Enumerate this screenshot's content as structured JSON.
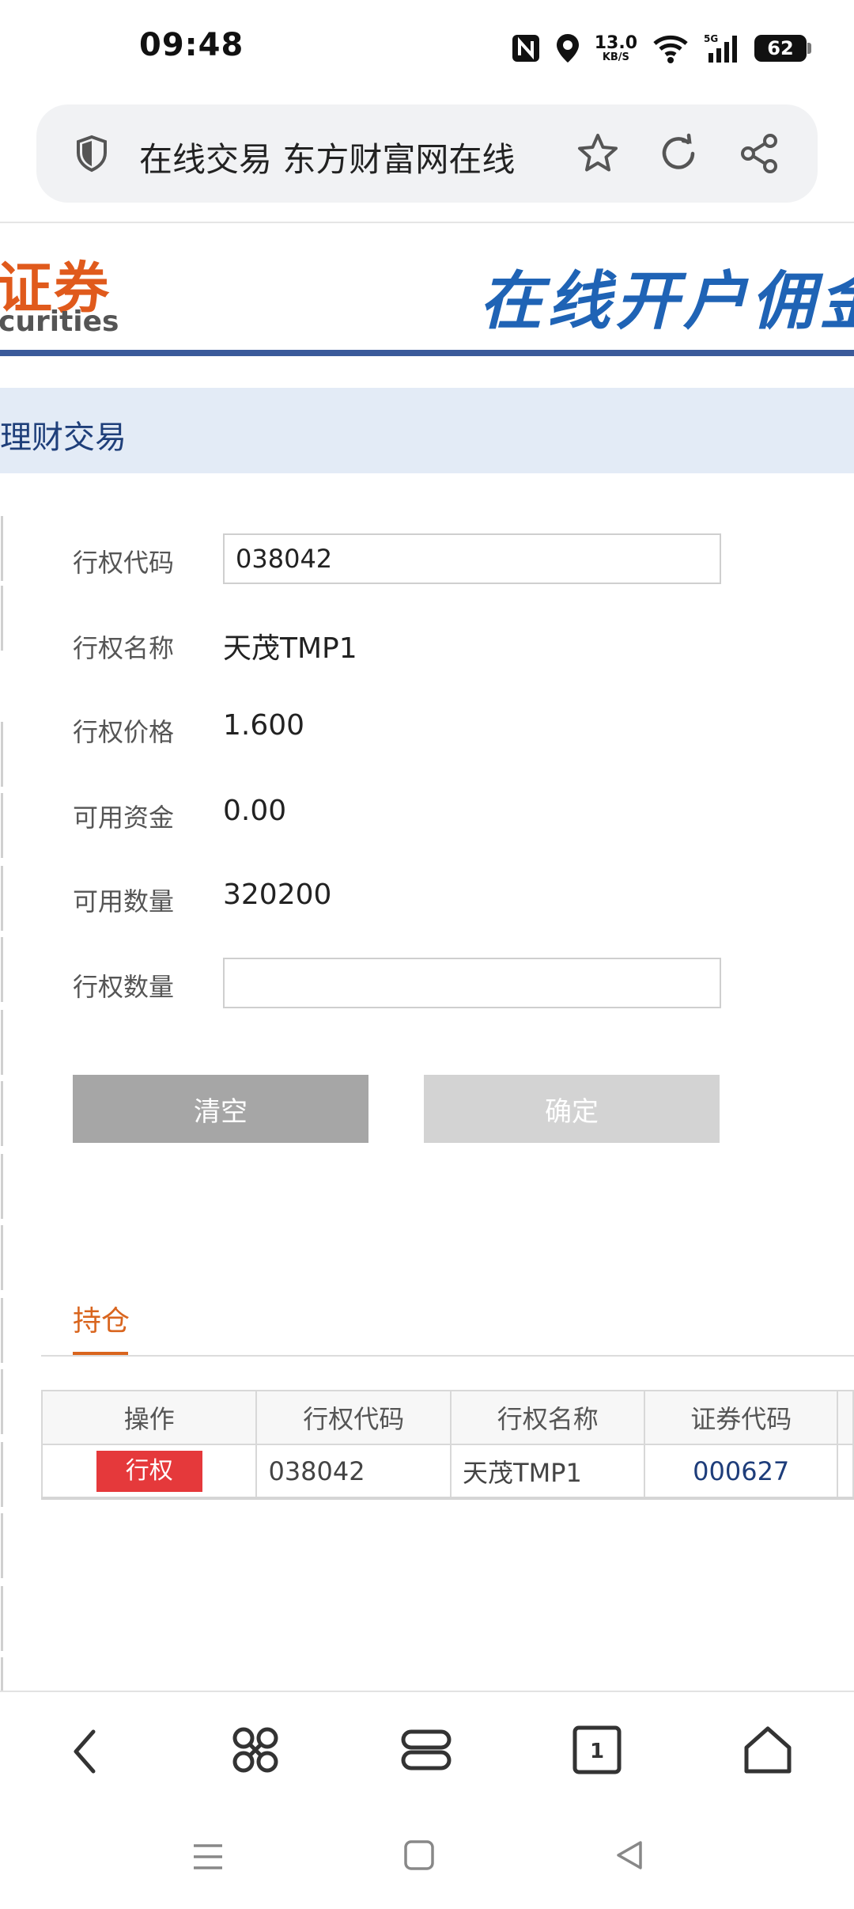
{
  "status_bar": {
    "time": "09:48",
    "net_speed_value": "13.0",
    "net_speed_unit": "KB/S",
    "network": "5G",
    "battery": "62"
  },
  "address_bar": {
    "title": "在线交易 东方财富网在线"
  },
  "banner": {
    "logo_cn": "证券",
    "logo_en": "curities",
    "slogan": "在线开户佣金"
  },
  "section": {
    "title": "理财交易"
  },
  "form": {
    "fields": [
      {
        "label": "行权代码",
        "value": "038042"
      },
      {
        "label": "行权名称",
        "value": "天茂TMP1"
      },
      {
        "label": "行权价格",
        "value": "1.600"
      },
      {
        "label": "可用资金",
        "value": "0.00"
      },
      {
        "label": "可用数量",
        "value": "320200"
      },
      {
        "label": "行权数量",
        "value": ""
      }
    ],
    "clear_label": "清空",
    "confirm_label": "确定"
  },
  "holdings": {
    "tab_label": "持仓",
    "columns": [
      "操作",
      "行权代码",
      "行权名称",
      "证券代码"
    ],
    "rows": [
      {
        "action": "行权",
        "exercise_code": "038042",
        "exercise_name": "天茂TMP1",
        "security_code": "000627"
      }
    ]
  },
  "colors": {
    "accent_orange": "#d9651e",
    "brand_blue": "#1f63b5",
    "exercise_red": "#e5393b"
  }
}
